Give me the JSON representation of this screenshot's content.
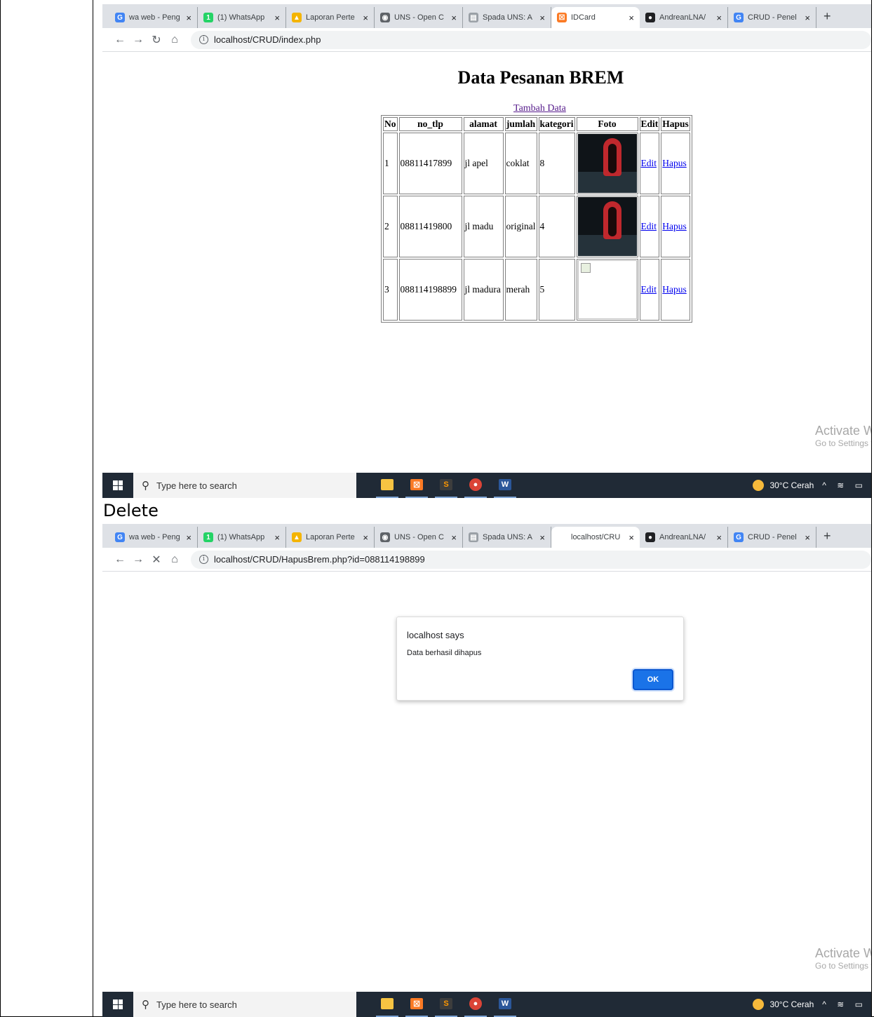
{
  "caption": "Delete",
  "screens": {
    "index": {
      "tabs": [
        {
          "title": "wa web - Peng",
          "favicon": "G",
          "color": "#4285f4"
        },
        {
          "title": "(1) WhatsApp",
          "favicon": "1",
          "color": "#25d366"
        },
        {
          "title": "Laporan Perte",
          "favicon": "▲",
          "color": "#f4b400"
        },
        {
          "title": "UNS - Open C",
          "favicon": "◉",
          "color": "#5f6368"
        },
        {
          "title": "Spada UNS: A",
          "favicon": "▤",
          "color": "#9aa0a6"
        },
        {
          "title": "IDCard",
          "favicon": "☒",
          "color": "#fb7a24",
          "active": true
        },
        {
          "title": "AndreanLNA/",
          "favicon": "●",
          "color": "#202124"
        },
        {
          "title": "CRUD - Penel",
          "favicon": "G",
          "color": "#4285f4"
        }
      ],
      "url": "localhost/CRUD/index.php",
      "page": {
        "title": "Data Pesanan BREM",
        "add_link": "Tambah Data",
        "headers": [
          "No",
          "no_tlp",
          "alamat",
          "jumlah",
          "kategori",
          "Foto",
          "Edit",
          "Hapus"
        ],
        "rows": [
          {
            "no": "1",
            "no_tlp": "08811417899",
            "alamat": "jl apel",
            "jumlah": "coklat",
            "kategori": "8",
            "edit": "Edit",
            "hapus": "Hapus"
          },
          {
            "no": "2",
            "no_tlp": "08811419800",
            "alamat": "jl madu",
            "jumlah": "original",
            "kategori": "4",
            "edit": "Edit",
            "hapus": "Hapus"
          },
          {
            "no": "3",
            "no_tlp": "088114198899",
            "alamat": "jl madura",
            "jumlah": "merah",
            "kategori": "5",
            "edit": "Edit",
            "hapus": "Hapus"
          }
        ]
      }
    },
    "delete": {
      "tabs": [
        {
          "title": "wa web - Peng",
          "favicon": "G",
          "color": "#4285f4"
        },
        {
          "title": "(1) WhatsApp",
          "favicon": "1",
          "color": "#25d366"
        },
        {
          "title": "Laporan Perte",
          "favicon": "▲",
          "color": "#f4b400"
        },
        {
          "title": "UNS - Open C",
          "favicon": "◉",
          "color": "#5f6368"
        },
        {
          "title": "Spada UNS: A",
          "favicon": "▤",
          "color": "#9aa0a6"
        },
        {
          "title": "localhost/CRU",
          "favicon": "·",
          "color": "#ffffff",
          "active": true
        },
        {
          "title": "AndreanLNA/",
          "favicon": "●",
          "color": "#202124"
        },
        {
          "title": "CRUD - Penel",
          "favicon": "G",
          "color": "#4285f4"
        }
      ],
      "url": "localhost/CRUD/HapusBrem.php?id=088114198899",
      "dialog": {
        "title": "localhost says",
        "message": "Data berhasil dihapus",
        "ok": "OK"
      }
    }
  },
  "watermark": {
    "title": "Activate Windows",
    "subtitle": "Go to Settings to activate Windows."
  },
  "taskbar": {
    "search_placeholder": "Type here to search",
    "weather": "30°C  Cerah"
  }
}
